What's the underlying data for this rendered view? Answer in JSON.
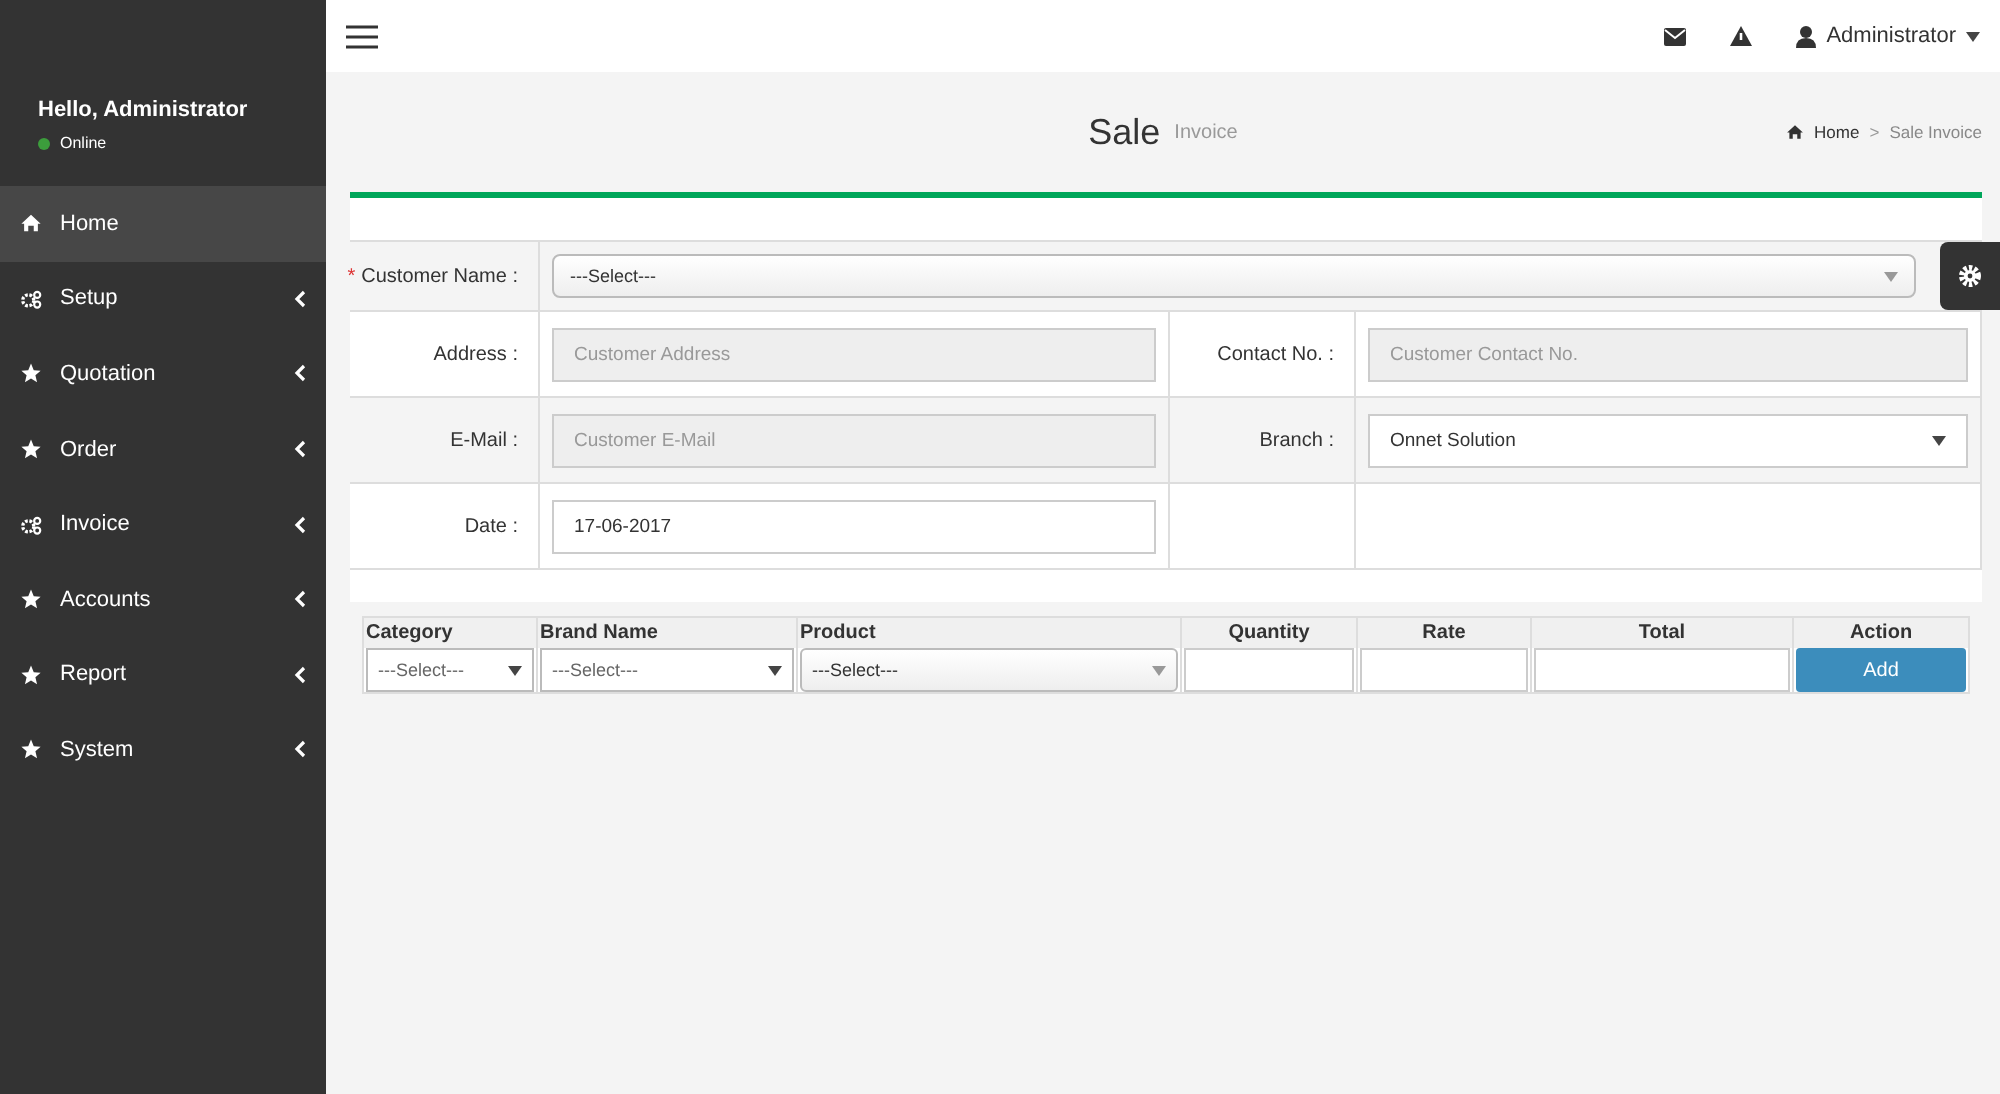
{
  "sidebar": {
    "greeting": "Hello, Administrator",
    "status": "Online",
    "online": true,
    "items": [
      {
        "label": "Home",
        "kind": "home",
        "selected": true,
        "expandable": false
      },
      {
        "label": "Setup",
        "kind": "gears",
        "selected": false,
        "expandable": true
      },
      {
        "label": "Quotation",
        "kind": "star",
        "selected": false,
        "expandable": true
      },
      {
        "label": "Order",
        "kind": "star",
        "selected": false,
        "expandable": true
      },
      {
        "label": "Invoice",
        "kind": "gears",
        "selected": false,
        "expandable": true
      },
      {
        "label": "Accounts",
        "kind": "star",
        "selected": false,
        "expandable": true
      },
      {
        "label": "Report",
        "kind": "star",
        "selected": false,
        "expandable": true
      },
      {
        "label": "System",
        "kind": "star",
        "selected": false,
        "expandable": true
      }
    ]
  },
  "topbar": {
    "user": "Administrator"
  },
  "page": {
    "title": "Sale",
    "subtitle": "Invoice",
    "breadcrumb": [
      "Home",
      "Sale Invoice"
    ],
    "separator": ">"
  },
  "customer": {
    "label": "Customer Name :",
    "required_mark": "*",
    "value": "---Select---"
  },
  "fields": [
    {
      "label": "Address :",
      "kind": "readonly",
      "placeholder": "Customer Address"
    },
    {
      "label": "Contact No. :",
      "kind": "readonly",
      "placeholder": "Customer Contact No."
    },
    {
      "label": "E-Mail :",
      "kind": "readonly",
      "placeholder": "Customer E-Mail"
    },
    {
      "label": "Branch :",
      "kind": "select",
      "value": "Onnet Solution"
    },
    {
      "label": "Date :",
      "kind": "input",
      "value": "17-06-2017"
    }
  ],
  "items_table": {
    "columns": [
      "Category",
      "Brand Name",
      "Product",
      "Quantity",
      "Rate",
      "Total",
      "Action"
    ],
    "cells": [
      {
        "kind": "select",
        "value": "---Select---"
      },
      {
        "kind": "select",
        "value": "---Select---"
      },
      {
        "kind": "dropdown",
        "value": "---Select---"
      },
      {
        "kind": "input"
      },
      {
        "kind": "input"
      },
      {
        "kind": "input"
      },
      {
        "kind": "button",
        "value": "Add"
      }
    ]
  }
}
